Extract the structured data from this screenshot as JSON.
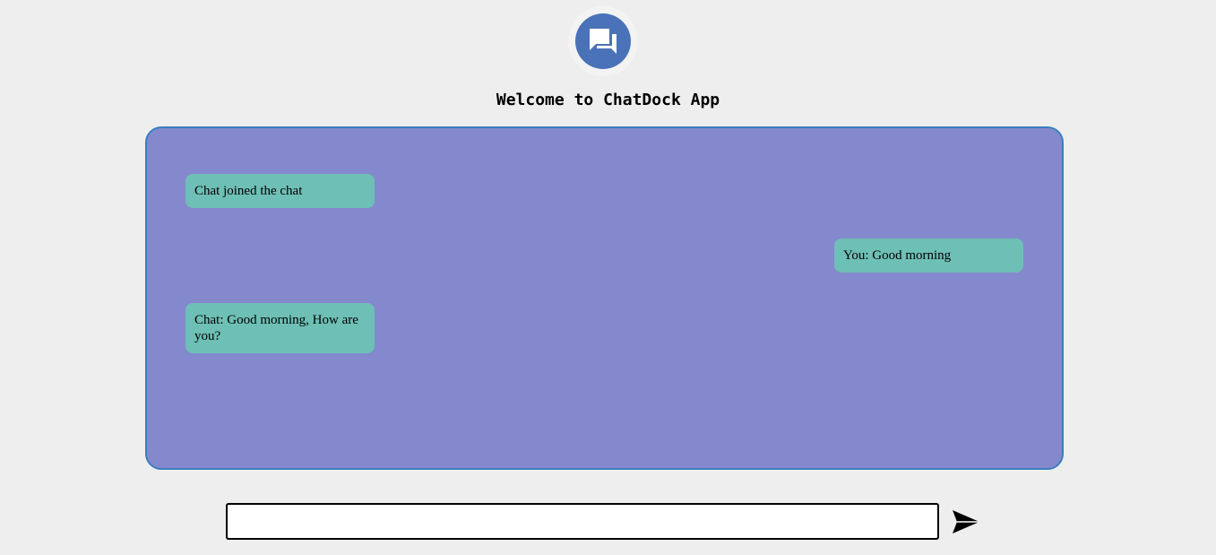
{
  "header": {
    "logo_icon": "chat-bubbles-icon",
    "title": "Welcome to ChatDock App"
  },
  "chat": {
    "messages": [
      {
        "side": "left",
        "text": "Chat joined the chat"
      },
      {
        "side": "right",
        "text": "You: Good morning"
      },
      {
        "side": "left",
        "text": "Chat: Good morning, How are you?"
      }
    ]
  },
  "composer": {
    "value": "",
    "placeholder": "",
    "send_icon": "send-icon"
  },
  "colors": {
    "background": "#eeeeee",
    "chat_area": "#8489cd",
    "chat_border": "#3a7ebf",
    "bubble": "#6ebfb5",
    "logo": "#4a72b8"
  }
}
